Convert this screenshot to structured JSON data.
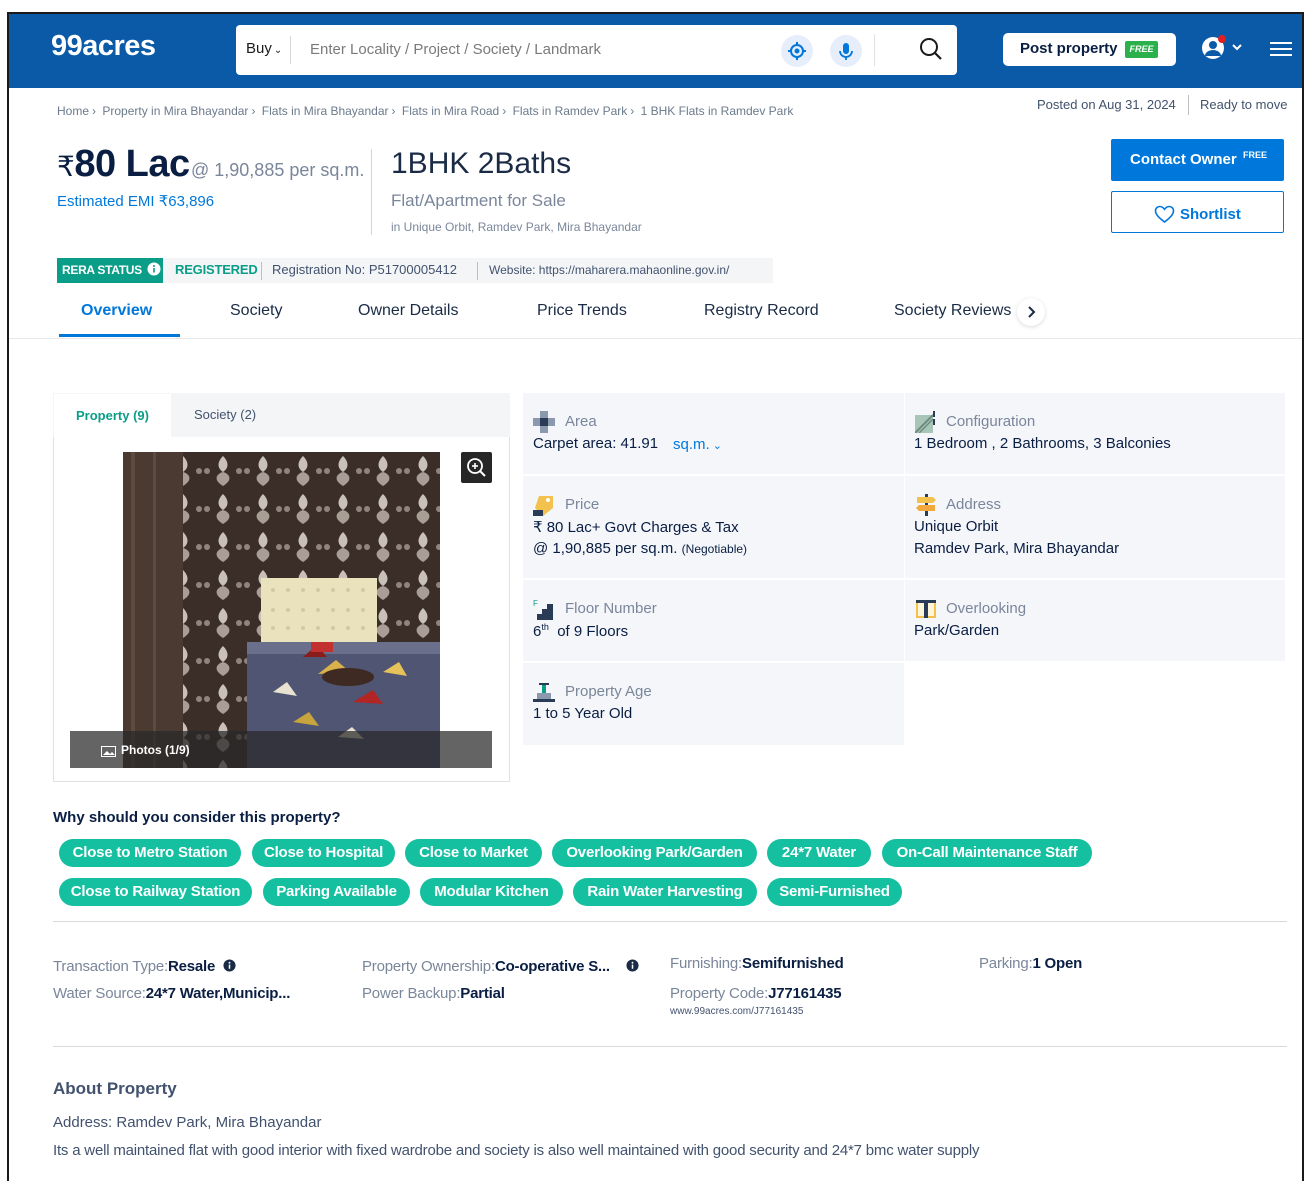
{
  "header": {
    "logo": "99acres",
    "search_mode": "Buy",
    "search_placeholder": "Enter Locality / Project / Society / Landmark",
    "post_property_label": "Post property",
    "post_property_tag": "FREE"
  },
  "breadcrumb": [
    "Home",
    "Property in Mira Bhayandar",
    "Flats in Mira Bhayandar",
    "Flats in Mira Road",
    "Flats in Ramdev Park",
    "1 BHK Flats in Ramdev Park"
  ],
  "posting": {
    "posted_on": "Posted on Aug 31, 2024",
    "status": "Ready to move"
  },
  "summary": {
    "currency": "₹",
    "price": "80 Lac",
    "price_per_unit": "@ 1,90,885 per sq.m.",
    "emi": "Estimated EMI ₹63,896",
    "title": "1BHK 2Baths",
    "type": "Flat/Apartment for Sale",
    "location": "in Unique Orbit, Ramdev Park, Mira Bhayandar"
  },
  "actions": {
    "contact_label": "Contact Owner",
    "contact_tag": "FREE",
    "shortlist_label": "Shortlist"
  },
  "rera": {
    "badge": "RERA STATUS",
    "status": "REGISTERED",
    "registration": "Registration No: P51700005412",
    "website": "Website: https://maharera.mahaonline.gov.in/"
  },
  "tabs": [
    "Overview",
    "Society",
    "Owner Details",
    "Price Trends",
    "Registry Record",
    "Society Reviews"
  ],
  "gallery": {
    "tab_property": "Property (9)",
    "tab_society": "Society (2)",
    "photo_count": "Photos (1/9)"
  },
  "details": {
    "area_label": "Area",
    "area_value": "Carpet area: 41.91",
    "area_unit": "sq.m.",
    "config_label": "Configuration",
    "config_value": "1 Bedroom , 2 Bathrooms, 3 Balconies",
    "price_label": "Price",
    "price_value_1": "₹ 80 Lac+ Govt Charges & Tax",
    "price_value_2": "@ 1,90,885 per sq.m.",
    "price_negotiable": "(Negotiable)",
    "address_label": "Address",
    "address_value_1": "Unique Orbit",
    "address_value_2": "Ramdev Park, Mira Bhayandar",
    "floor_label": "Floor Number",
    "floor_num": "6",
    "floor_sup": "th",
    "floor_rest": "of 9 Floors",
    "overlooking_label": "Overlooking",
    "overlooking_value": "Park/Garden",
    "age_label": "Property Age",
    "age_value": "1 to 5 Year Old"
  },
  "why": {
    "heading": "Why should you consider this property?",
    "chips": [
      "Close to Metro Station",
      "Close to Hospital",
      "Close to Market",
      "Overlooking Park/Garden",
      "24*7 Water",
      "On-Call Maintenance Staff",
      "Close to Railway Station",
      "Parking Available",
      "Modular Kitchen",
      "Rain Water Harvesting",
      "Semi-Furnished"
    ]
  },
  "meta": {
    "transaction_label": "Transaction Type",
    "transaction_value": "Resale",
    "water_label": "Water Source",
    "water_value": "24*7 Water,Municip...",
    "ownership_label": "Property Ownership",
    "ownership_value": "Co-operative S...",
    "backup_label": "Power Backup",
    "backup_value": "Partial",
    "furnishing_label": "Furnishing",
    "furnishing_value": "Semifurnished",
    "code_label": "Property Code",
    "code_value": "J77161435",
    "code_url": "www.99acres.com/J77161435",
    "parking_label": "Parking",
    "parking_value": "1 Open"
  },
  "about": {
    "heading": "About Property",
    "address_label": "Address:",
    "address_value": "Ramdev Park, Mira Bhayandar",
    "description": "Its a well maintained flat with good interior with fixed wardrobe and society is also well maintained with good security and 24*7 bmc water supply"
  },
  "colors": {
    "brand_blue": "#0a5aa8",
    "accent_blue": "#0078db",
    "teal": "#0a9e88",
    "chip": "#15c0a1"
  }
}
